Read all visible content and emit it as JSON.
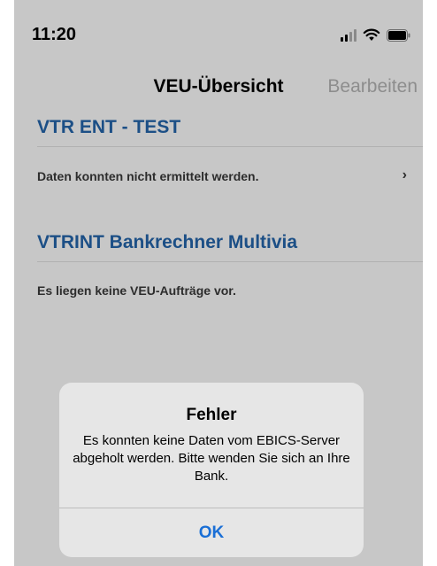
{
  "status_bar": {
    "time": "11:20",
    "icons": [
      "signal-icon",
      "wifi-icon",
      "battery-icon"
    ]
  },
  "nav": {
    "title": "VEU-Übersicht",
    "edit_label": "Bearbeiten"
  },
  "sections": [
    {
      "title": "VTR ENT - TEST",
      "row_text": "Daten konnten nicht ermittelt werden.",
      "chevron": "›"
    },
    {
      "title": "VTRINT Bankrechner Multivia",
      "row_text": "Es liegen keine VEU-Aufträge vor."
    }
  ],
  "alert": {
    "title": "Fehler",
    "message": "Es konnten keine Daten vom EBICS-Server abgeholt werden. Bitte wenden Sie sich an Ihre Bank.",
    "ok_label": "OK"
  },
  "colors": {
    "section_title": "#1c4f86",
    "button_blue": "#1a6fd6",
    "dimmed_background": "#c7c7c7"
  }
}
